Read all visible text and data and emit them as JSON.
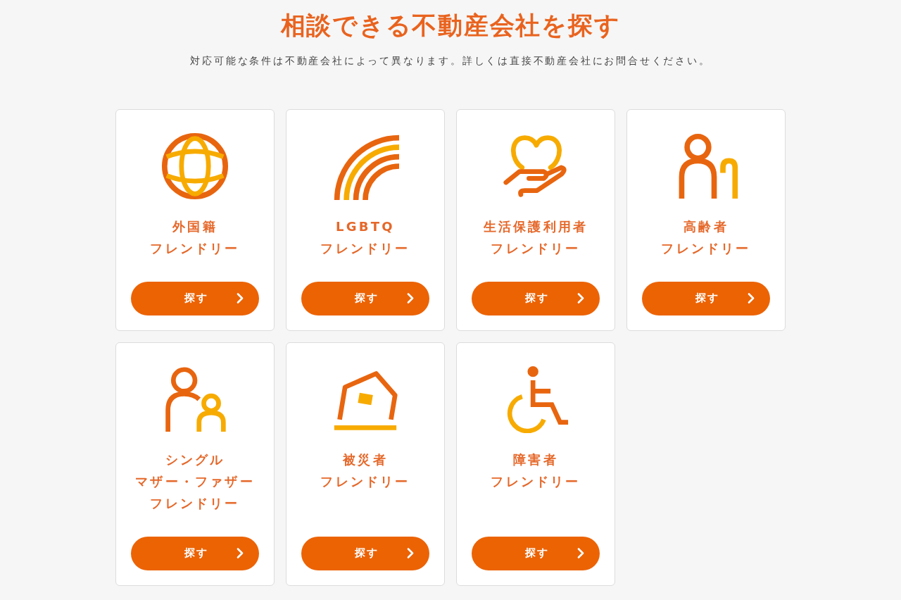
{
  "heading": "相談できる不動産会社を探す",
  "description": "対応可能な条件は不動産会社によって異なります。詳しくは直接不動産会社にお問合せください。",
  "categories": [
    {
      "kind": "globe",
      "label": [
        "外国籍",
        "フレンドリー"
      ],
      "button": "探す"
    },
    {
      "kind": "rainbow",
      "label": [
        "LGBTQ",
        "フレンドリー"
      ],
      "button": "探す"
    },
    {
      "kind": "heart-hand",
      "label": [
        "生活保護利用者",
        "フレンドリー"
      ],
      "button": "探す"
    },
    {
      "kind": "elder",
      "label": [
        "高齢者",
        "フレンドリー"
      ],
      "button": "探す"
    },
    {
      "kind": "parent-child",
      "label": [
        "シングル",
        "マザー・ファザー",
        "フレンドリー"
      ],
      "button": "探す"
    },
    {
      "kind": "house",
      "label": [
        "被災者",
        "フレンドリー"
      ],
      "button": "探す"
    },
    {
      "kind": "wheelchair",
      "label": [
        "障害者",
        "フレンドリー"
      ],
      "button": "探す"
    }
  ]
}
